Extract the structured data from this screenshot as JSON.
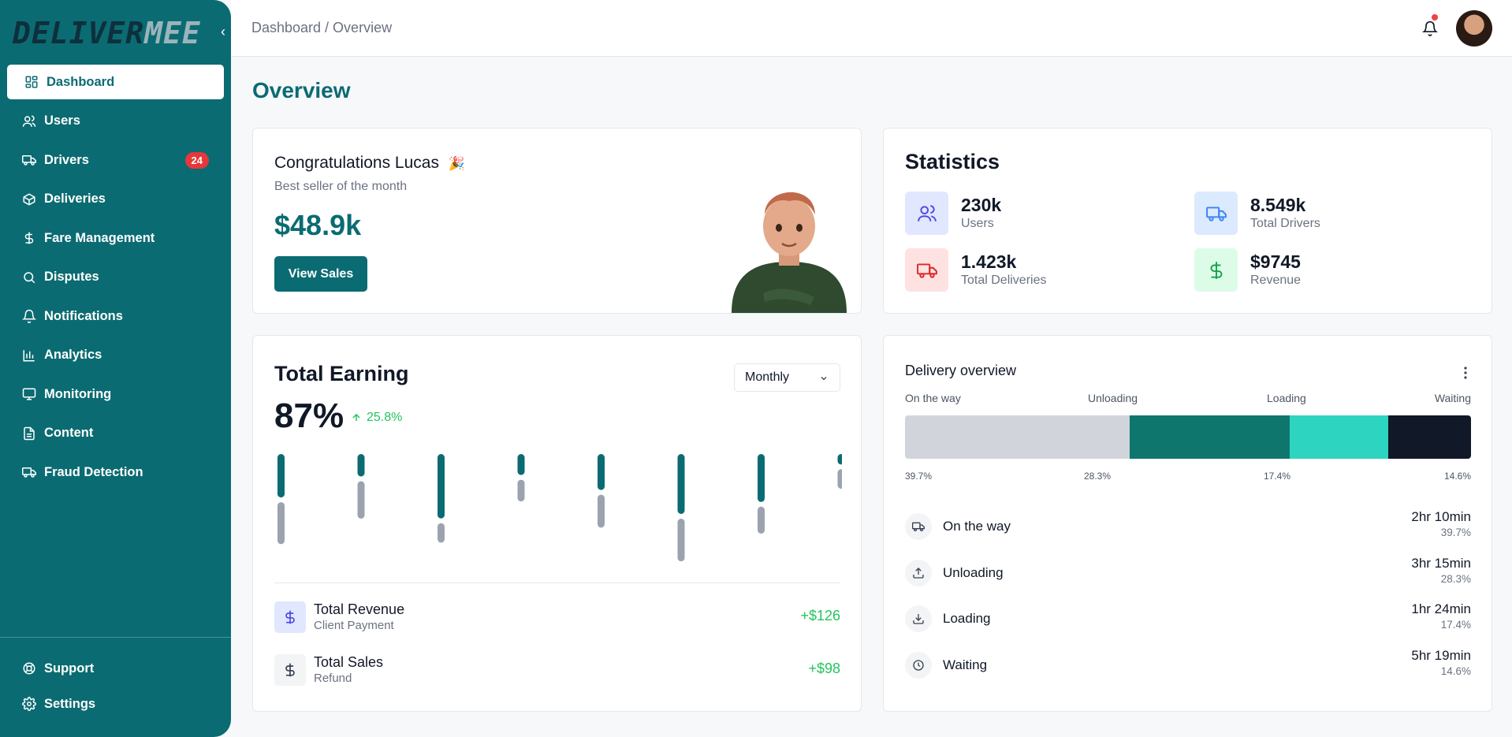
{
  "brand": {
    "logo_part1": "DELIVER",
    "logo_part2": "MEE"
  },
  "sidebar": {
    "items": [
      {
        "label": "Dashboard",
        "icon": "dashboard-icon",
        "active": true
      },
      {
        "label": "Users",
        "icon": "users-icon"
      },
      {
        "label": "Drivers",
        "icon": "truck-icon",
        "badge": "24"
      },
      {
        "label": "Deliveries",
        "icon": "package-icon"
      },
      {
        "label": "Fare Management",
        "icon": "dollar-icon"
      },
      {
        "label": "Disputes",
        "icon": "search-icon"
      },
      {
        "label": "Notifications",
        "icon": "bell-icon"
      },
      {
        "label": "Analytics",
        "icon": "chart-icon"
      },
      {
        "label": "Monitoring",
        "icon": "monitor-icon"
      },
      {
        "label": "Content",
        "icon": "document-icon"
      },
      {
        "label": "Fraud Detection",
        "icon": "truck-icon"
      }
    ],
    "bottom": [
      {
        "label": "Support",
        "icon": "lifebuoy-icon"
      },
      {
        "label": "Settings",
        "icon": "gear-icon"
      }
    ]
  },
  "header": {
    "breadcrumb": "Dashboard / Overview"
  },
  "page": {
    "title": "Overview"
  },
  "congrats": {
    "title": "Congratulations Lucas",
    "emoji": "🎉",
    "subtitle": "Best seller of the month",
    "amount": "$48.9k",
    "button": "View Sales"
  },
  "statistics": {
    "title": "Statistics",
    "items": [
      {
        "value": "230k",
        "label": "Users",
        "icon": "users-icon",
        "color": "#4f46e5",
        "bg": "#e0e7ff"
      },
      {
        "value": "8.549k",
        "label": "Total Drivers",
        "icon": "truck-icon",
        "color": "#3b82f6",
        "bg": "#dbeafe"
      },
      {
        "value": "1.423k",
        "label": "Total Deliveries",
        "icon": "truck-icon",
        "color": "#dc2626",
        "bg": "#fee2e2"
      },
      {
        "value": "$9745",
        "label": "Revenue",
        "icon": "dollar-icon",
        "color": "#16a34a",
        "bg": "#dcfce7"
      }
    ]
  },
  "earning": {
    "title": "Total Earning",
    "period": "Monthly",
    "percent": "87%",
    "trend": "25.8%",
    "rows": [
      {
        "title": "Total Revenue",
        "subtitle": "Client Payment",
        "amount": "+$126",
        "icon": "dollar-icon"
      },
      {
        "title": "Total Sales",
        "subtitle": "Refund",
        "amount": "+$98",
        "icon": "dollar-icon"
      }
    ]
  },
  "chart_data": {
    "type": "bar",
    "categories": [
      "",
      "",
      "",
      "",
      "",
      "",
      "",
      ""
    ],
    "series": [
      {
        "values": [
          58,
          30,
          86,
          28,
          48,
          80,
          64,
          14
        ]
      },
      {
        "values": [
          56,
          50,
          26,
          29,
          44,
          57,
          36,
          26
        ]
      }
    ],
    "colors": [
      "#0b6b72",
      "#9ca3af"
    ]
  },
  "delivery": {
    "title": "Delivery overview",
    "segments": [
      {
        "label": "On the way",
        "pct": "39.7%",
        "value": 39.7,
        "color": "#d1d5db"
      },
      {
        "label": "Unloading",
        "pct": "28.3%",
        "value": 28.3,
        "color": "#0f766e"
      },
      {
        "label": "Loading",
        "pct": "17.4%",
        "value": 17.4,
        "color": "#2dd4bf"
      },
      {
        "label": "Waiting",
        "pct": "14.6%",
        "value": 14.6,
        "color": "#111827"
      }
    ],
    "rows": [
      {
        "name": "On the way",
        "time": "2hr 10min",
        "pct": "39.7%",
        "icon": "truck-icon"
      },
      {
        "name": "Unloading",
        "time": "3hr 15min",
        "pct": "28.3%",
        "icon": "upload-icon"
      },
      {
        "name": "Loading",
        "time": "1hr 24min",
        "pct": "17.4%",
        "icon": "download-icon"
      },
      {
        "name": "Waiting",
        "time": "5hr 19min",
        "pct": "14.6%",
        "icon": "clock-icon"
      }
    ]
  }
}
